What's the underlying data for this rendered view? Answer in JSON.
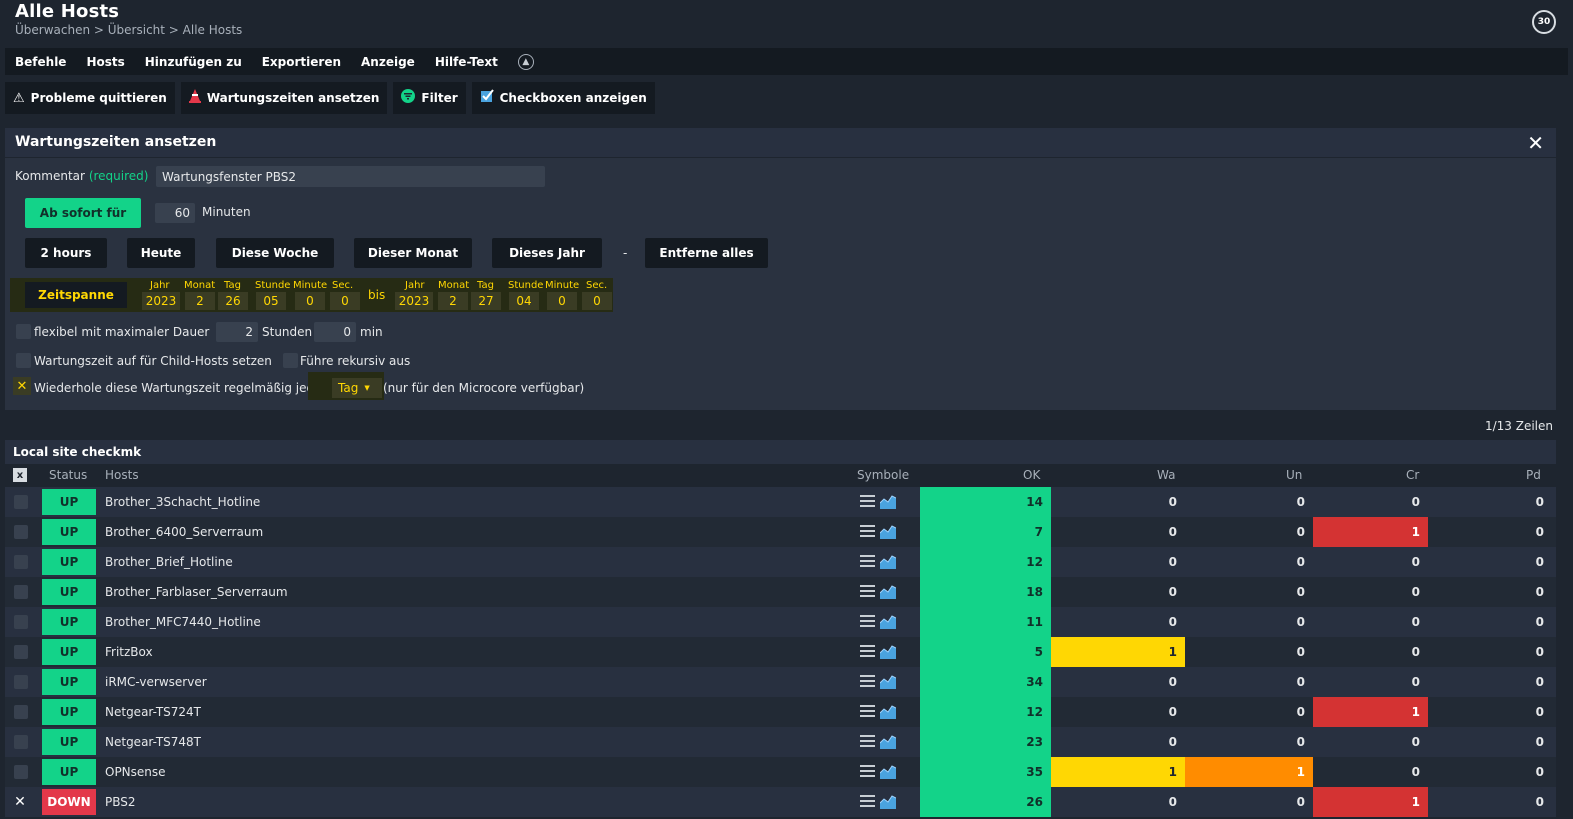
{
  "header": {
    "title": "Alle Hosts",
    "breadcrumb": "Überwachen > Übersicht > Alle Hosts",
    "reload_seconds": "30"
  },
  "menubar": {
    "items": [
      "Befehle",
      "Hosts",
      "Hinzufügen zu",
      "Exportieren",
      "Anzeige",
      "Hilfe-Text"
    ],
    "toggle_icon": "chevron-up-icon"
  },
  "toolbar": {
    "buttons": [
      {
        "label": "Probleme quittieren",
        "icon": "warning-icon"
      },
      {
        "label": "Wartungszeiten ansetzen",
        "icon": "cone-icon"
      },
      {
        "label": "Filter",
        "icon": "filter-icon"
      },
      {
        "label": "Checkboxen anzeigen",
        "icon": "checkbox-icon"
      }
    ]
  },
  "form": {
    "title": "Wartungszeiten ansetzen",
    "comment_label": "Kommentar",
    "comment_required": "(required)",
    "comment_value": "Wartungsfenster PBS2",
    "immediate_button": "Ab sofort für",
    "minutes_value": "60",
    "minutes_label": "Minuten",
    "quick_buttons": [
      "2 hours",
      "Heute",
      "Diese Woche",
      "Dieser Monat",
      "Dieses Jahr"
    ],
    "separator": "-",
    "remove_button": "Entferne alles",
    "range_button": "Zeitspanne",
    "date_labels": [
      "Jahr",
      "Monat",
      "Tag",
      "Stunde",
      "Minute",
      "Sec."
    ],
    "from_values": [
      "2023",
      "2",
      "26",
      "05",
      "0",
      "0"
    ],
    "until_label": "bis",
    "to_values": [
      "2023",
      "2",
      "27",
      "04",
      "0",
      "0"
    ],
    "flexible_label": "flexibel mit maximaler Dauer",
    "flex_hours_value": "2",
    "flex_hours_label": "Stunden",
    "flex_min_value": "0",
    "flex_min_label": "min",
    "child_hosts_label": "Wartungszeit auf für Child-Hosts setzen",
    "recursive_label": "Führe rekursiv aus",
    "repeat_label": "Wiederhole diese Wartungszeit regelmäßig jede",
    "repeat_select": "Tag",
    "repeat_note": "(nur für den Microcore verfügbar)"
  },
  "table": {
    "row_count": "1/13 Zeilen",
    "site_title": "Local site checkmk",
    "headers": {
      "status": "Status",
      "hosts": "Hosts",
      "symbols": "Symbole",
      "ok": "OK",
      "wa": "Wa",
      "un": "Un",
      "cr": "Cr",
      "pd": "Pd"
    },
    "select_all_mark": "x",
    "rows": [
      {
        "checked": false,
        "status": "UP",
        "host": "Brother_3Schacht_Hotline",
        "ok": "14",
        "wa": "0",
        "un": "0",
        "cr": "0",
        "pd": "0"
      },
      {
        "checked": false,
        "status": "UP",
        "host": "Brother_6400_Serverraum",
        "ok": "7",
        "wa": "0",
        "un": "0",
        "cr": "1",
        "pd": "0"
      },
      {
        "checked": false,
        "status": "UP",
        "host": "Brother_Brief_Hotline",
        "ok": "12",
        "wa": "0",
        "un": "0",
        "cr": "0",
        "pd": "0"
      },
      {
        "checked": false,
        "status": "UP",
        "host": "Brother_Farblaser_Serverraum",
        "ok": "18",
        "wa": "0",
        "un": "0",
        "cr": "0",
        "pd": "0"
      },
      {
        "checked": false,
        "status": "UP",
        "host": "Brother_MFC7440_Hotline",
        "ok": "11",
        "wa": "0",
        "un": "0",
        "cr": "0",
        "pd": "0"
      },
      {
        "checked": false,
        "status": "UP",
        "host": "FritzBox",
        "ok": "5",
        "wa": "1",
        "un": "0",
        "cr": "0",
        "pd": "0"
      },
      {
        "checked": false,
        "status": "UP",
        "host": "iRMC-verwserver",
        "ok": "34",
        "wa": "0",
        "un": "0",
        "cr": "0",
        "pd": "0"
      },
      {
        "checked": false,
        "status": "UP",
        "host": "Netgear-TS724T",
        "ok": "12",
        "wa": "0",
        "un": "0",
        "cr": "1",
        "pd": "0"
      },
      {
        "checked": false,
        "status": "UP",
        "host": "Netgear-TS748T",
        "ok": "23",
        "wa": "0",
        "un": "0",
        "cr": "0",
        "pd": "0"
      },
      {
        "checked": false,
        "status": "UP",
        "host": "OPNsense",
        "ok": "35",
        "wa": "1",
        "un": "1",
        "cr": "0",
        "pd": "0"
      },
      {
        "checked": true,
        "status": "DOWN",
        "host": "PBS2",
        "ok": "26",
        "wa": "0",
        "un": "0",
        "cr": "1",
        "pd": "0"
      }
    ]
  },
  "colors": {
    "ok": "#13d389",
    "warn": "#ffd703",
    "unknown": "#ff8c00",
    "crit": "#d43333",
    "down": "#e3384a",
    "highlight": "#ffd703"
  }
}
